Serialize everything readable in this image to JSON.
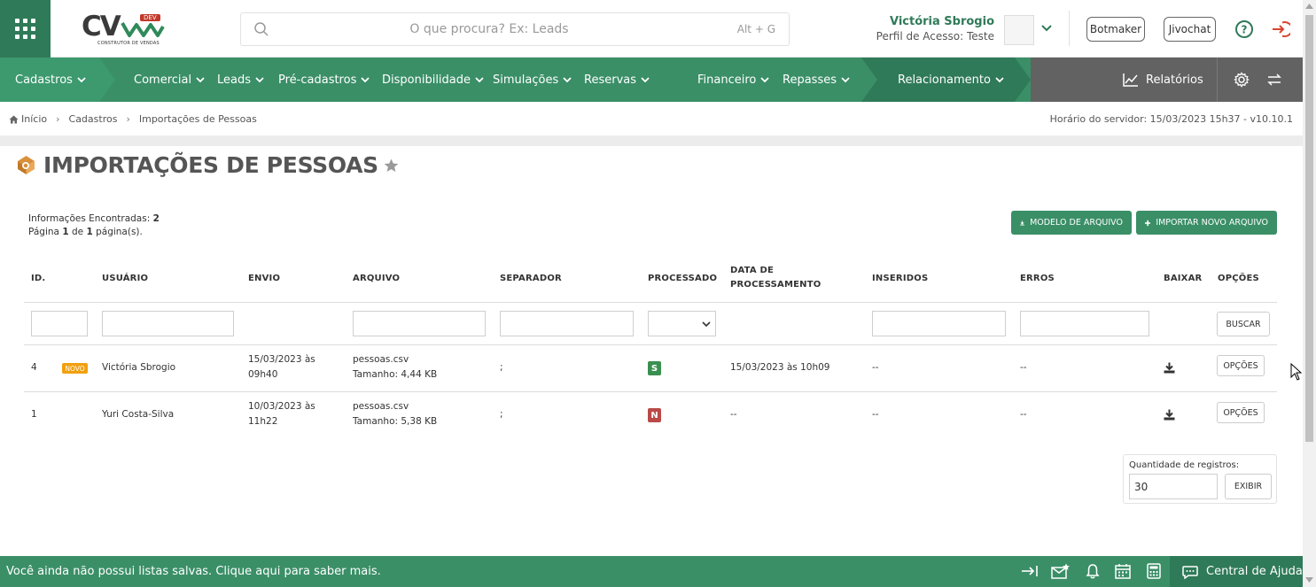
{
  "header": {
    "logo_text": "CV",
    "logo_badge": "DEV",
    "logo_subtitle": "CONSTRUTOR DE VENDAS",
    "search_placeholder": "O que procura? Ex: Leads",
    "search_shortcut": "Alt + G",
    "user_name": "Victória Sbrogio",
    "user_profile": "Perfil de Acesso: Teste",
    "botmaker_label": "Botmaker",
    "jivochat_label": "Jivochat"
  },
  "nav": {
    "items": [
      {
        "label": "Cadastros"
      },
      {
        "label": "Comercial"
      },
      {
        "label": "Leads"
      },
      {
        "label": "Pré-cadastros"
      },
      {
        "label": "Disponibilidade"
      },
      {
        "label": "Simulações"
      },
      {
        "label": "Reservas"
      },
      {
        "label": "Financeiro"
      },
      {
        "label": "Repasses"
      },
      {
        "label": "Relacionamento"
      }
    ],
    "reports_label": "Relatórios"
  },
  "breadcrumb": [
    "Início",
    "Cadastros",
    "Importações de Pessoas"
  ],
  "server_time": "Horário do servidor: 15/03/2023 15h37 - v10.10.1",
  "page": {
    "title": "IMPORTAÇÕES DE PESSOAS",
    "info_found_label": "Informações Encontradas:",
    "info_found_count": "2",
    "page_label": "Página",
    "page_current": "1",
    "page_of": "de",
    "page_total": "1",
    "page_suffix": "página(s).",
    "btn_model": "MODELO DE ARQUIVO",
    "btn_import": "IMPORTAR NOVO ARQUIVO"
  },
  "table": {
    "headers": {
      "id": "ID.",
      "user": "USUÁRIO",
      "sent": "ENVIO",
      "file": "ARQUIVO",
      "separator": "SEPARADOR",
      "processed": "PROCESSADO",
      "processing_date_1": "DATA DE",
      "processing_date_2": "PROCESSAMENTO",
      "inserted": "INSERIDOS",
      "errors": "ERROS",
      "download": "BAIXAR",
      "options": "OPÇÕES"
    },
    "search_button": "BUSCAR",
    "rows": [
      {
        "id": "4",
        "badge": "NOVO",
        "user": "Victória Sbrogio",
        "sent_line1": "15/03/2023 às",
        "sent_line2": "09h40",
        "file_name": "pessoas.csv",
        "file_size": "Tamanho: 4,44 KB",
        "separator": ";",
        "processed": "S",
        "processed_color": "#3a8f50",
        "processing_date": "15/03/2023 às 10h09",
        "inserted": "--",
        "errors": "--",
        "options_label": "OPÇÕES"
      },
      {
        "id": "1",
        "user": "Yuri Costa-Silva",
        "sent_line1": "10/03/2023 às",
        "sent_line2": "11h22",
        "file_name": "pessoas.csv",
        "file_size": "Tamanho: 5,38 KB",
        "separator": ";",
        "processed": "N",
        "processed_color": "#b94a48",
        "processing_date": "--",
        "inserted": "--",
        "errors": "--",
        "options_label": "OPÇÕES"
      }
    ]
  },
  "pagination": {
    "qty_label": "Quantidade de registros:",
    "qty_value": "30",
    "show_button": "EXIBIR"
  },
  "footer": {
    "message": "Você ainda não possui listas salvas. Clique aqui para saber mais.",
    "help_center": "Central de Ajuda"
  },
  "colors": {
    "brand_green": "#3a8f67",
    "dark_green": "#2f7a58",
    "nav_gray": "#626262"
  }
}
